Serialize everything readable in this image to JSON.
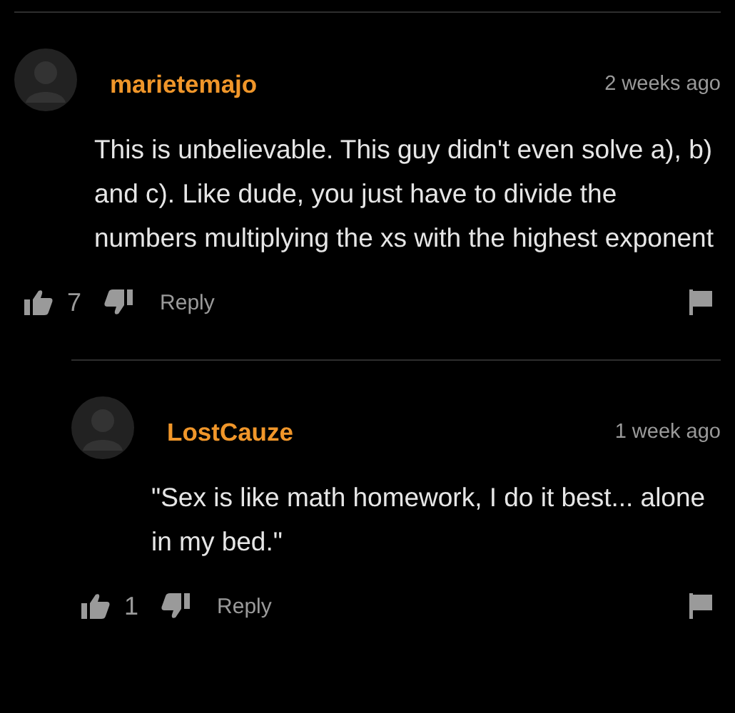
{
  "comments": [
    {
      "author": "marietemajo",
      "time": "2 weeks ago",
      "text": "This is unbelievable. This guy didn't even solve a), b) and c). Like dude, you just have to divide the numbers multiplying the xs with the highest exponent",
      "likes": "7",
      "reply_label": "Reply",
      "replies": [
        {
          "author": "LostCauze",
          "time": "1 week ago",
          "text": "\"Sex is like math homework, I do it best... alone in my bed.\"",
          "likes": "1",
          "reply_label": "Reply"
        }
      ]
    }
  ]
}
